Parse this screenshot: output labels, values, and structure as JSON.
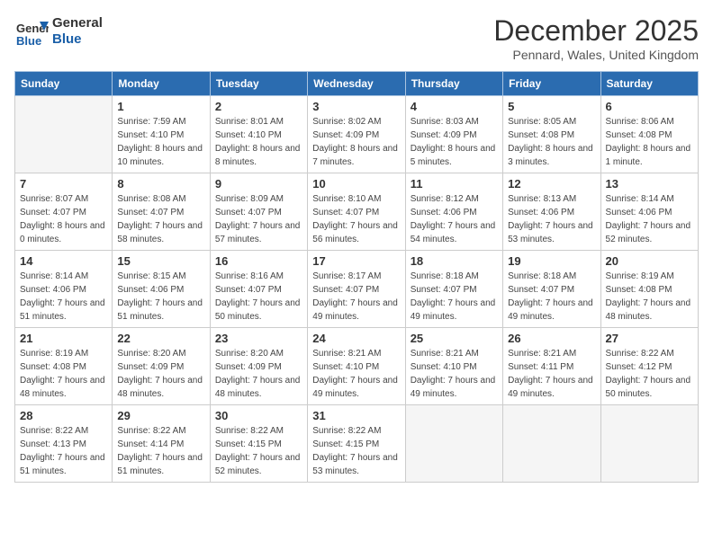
{
  "logo": {
    "general": "General",
    "blue": "Blue"
  },
  "header": {
    "month": "December 2025",
    "location": "Pennard, Wales, United Kingdom"
  },
  "days_of_week": [
    "Sunday",
    "Monday",
    "Tuesday",
    "Wednesday",
    "Thursday",
    "Friday",
    "Saturday"
  ],
  "weeks": [
    [
      {
        "day": "",
        "sunrise": "",
        "sunset": "",
        "daylight": ""
      },
      {
        "day": "1",
        "sunrise": "Sunrise: 7:59 AM",
        "sunset": "Sunset: 4:10 PM",
        "daylight": "Daylight: 8 hours and 10 minutes."
      },
      {
        "day": "2",
        "sunrise": "Sunrise: 8:01 AM",
        "sunset": "Sunset: 4:10 PM",
        "daylight": "Daylight: 8 hours and 8 minutes."
      },
      {
        "day": "3",
        "sunrise": "Sunrise: 8:02 AM",
        "sunset": "Sunset: 4:09 PM",
        "daylight": "Daylight: 8 hours and 7 minutes."
      },
      {
        "day": "4",
        "sunrise": "Sunrise: 8:03 AM",
        "sunset": "Sunset: 4:09 PM",
        "daylight": "Daylight: 8 hours and 5 minutes."
      },
      {
        "day": "5",
        "sunrise": "Sunrise: 8:05 AM",
        "sunset": "Sunset: 4:08 PM",
        "daylight": "Daylight: 8 hours and 3 minutes."
      },
      {
        "day": "6",
        "sunrise": "Sunrise: 8:06 AM",
        "sunset": "Sunset: 4:08 PM",
        "daylight": "Daylight: 8 hours and 1 minute."
      }
    ],
    [
      {
        "day": "7",
        "sunrise": "Sunrise: 8:07 AM",
        "sunset": "Sunset: 4:07 PM",
        "daylight": "Daylight: 8 hours and 0 minutes."
      },
      {
        "day": "8",
        "sunrise": "Sunrise: 8:08 AM",
        "sunset": "Sunset: 4:07 PM",
        "daylight": "Daylight: 7 hours and 58 minutes."
      },
      {
        "day": "9",
        "sunrise": "Sunrise: 8:09 AM",
        "sunset": "Sunset: 4:07 PM",
        "daylight": "Daylight: 7 hours and 57 minutes."
      },
      {
        "day": "10",
        "sunrise": "Sunrise: 8:10 AM",
        "sunset": "Sunset: 4:07 PM",
        "daylight": "Daylight: 7 hours and 56 minutes."
      },
      {
        "day": "11",
        "sunrise": "Sunrise: 8:12 AM",
        "sunset": "Sunset: 4:06 PM",
        "daylight": "Daylight: 7 hours and 54 minutes."
      },
      {
        "day": "12",
        "sunrise": "Sunrise: 8:13 AM",
        "sunset": "Sunset: 4:06 PM",
        "daylight": "Daylight: 7 hours and 53 minutes."
      },
      {
        "day": "13",
        "sunrise": "Sunrise: 8:14 AM",
        "sunset": "Sunset: 4:06 PM",
        "daylight": "Daylight: 7 hours and 52 minutes."
      }
    ],
    [
      {
        "day": "14",
        "sunrise": "Sunrise: 8:14 AM",
        "sunset": "Sunset: 4:06 PM",
        "daylight": "Daylight: 7 hours and 51 minutes."
      },
      {
        "day": "15",
        "sunrise": "Sunrise: 8:15 AM",
        "sunset": "Sunset: 4:06 PM",
        "daylight": "Daylight: 7 hours and 51 minutes."
      },
      {
        "day": "16",
        "sunrise": "Sunrise: 8:16 AM",
        "sunset": "Sunset: 4:07 PM",
        "daylight": "Daylight: 7 hours and 50 minutes."
      },
      {
        "day": "17",
        "sunrise": "Sunrise: 8:17 AM",
        "sunset": "Sunset: 4:07 PM",
        "daylight": "Daylight: 7 hours and 49 minutes."
      },
      {
        "day": "18",
        "sunrise": "Sunrise: 8:18 AM",
        "sunset": "Sunset: 4:07 PM",
        "daylight": "Daylight: 7 hours and 49 minutes."
      },
      {
        "day": "19",
        "sunrise": "Sunrise: 8:18 AM",
        "sunset": "Sunset: 4:07 PM",
        "daylight": "Daylight: 7 hours and 49 minutes."
      },
      {
        "day": "20",
        "sunrise": "Sunrise: 8:19 AM",
        "sunset": "Sunset: 4:08 PM",
        "daylight": "Daylight: 7 hours and 48 minutes."
      }
    ],
    [
      {
        "day": "21",
        "sunrise": "Sunrise: 8:19 AM",
        "sunset": "Sunset: 4:08 PM",
        "daylight": "Daylight: 7 hours and 48 minutes."
      },
      {
        "day": "22",
        "sunrise": "Sunrise: 8:20 AM",
        "sunset": "Sunset: 4:09 PM",
        "daylight": "Daylight: 7 hours and 48 minutes."
      },
      {
        "day": "23",
        "sunrise": "Sunrise: 8:20 AM",
        "sunset": "Sunset: 4:09 PM",
        "daylight": "Daylight: 7 hours and 48 minutes."
      },
      {
        "day": "24",
        "sunrise": "Sunrise: 8:21 AM",
        "sunset": "Sunset: 4:10 PM",
        "daylight": "Daylight: 7 hours and 49 minutes."
      },
      {
        "day": "25",
        "sunrise": "Sunrise: 8:21 AM",
        "sunset": "Sunset: 4:10 PM",
        "daylight": "Daylight: 7 hours and 49 minutes."
      },
      {
        "day": "26",
        "sunrise": "Sunrise: 8:21 AM",
        "sunset": "Sunset: 4:11 PM",
        "daylight": "Daylight: 7 hours and 49 minutes."
      },
      {
        "day": "27",
        "sunrise": "Sunrise: 8:22 AM",
        "sunset": "Sunset: 4:12 PM",
        "daylight": "Daylight: 7 hours and 50 minutes."
      }
    ],
    [
      {
        "day": "28",
        "sunrise": "Sunrise: 8:22 AM",
        "sunset": "Sunset: 4:13 PM",
        "daylight": "Daylight: 7 hours and 51 minutes."
      },
      {
        "day": "29",
        "sunrise": "Sunrise: 8:22 AM",
        "sunset": "Sunset: 4:14 PM",
        "daylight": "Daylight: 7 hours and 51 minutes."
      },
      {
        "day": "30",
        "sunrise": "Sunrise: 8:22 AM",
        "sunset": "Sunset: 4:15 PM",
        "daylight": "Daylight: 7 hours and 52 minutes."
      },
      {
        "day": "31",
        "sunrise": "Sunrise: 8:22 AM",
        "sunset": "Sunset: 4:15 PM",
        "daylight": "Daylight: 7 hours and 53 minutes."
      },
      {
        "day": "",
        "sunrise": "",
        "sunset": "",
        "daylight": ""
      },
      {
        "day": "",
        "sunrise": "",
        "sunset": "",
        "daylight": ""
      },
      {
        "day": "",
        "sunrise": "",
        "sunset": "",
        "daylight": ""
      }
    ]
  ]
}
